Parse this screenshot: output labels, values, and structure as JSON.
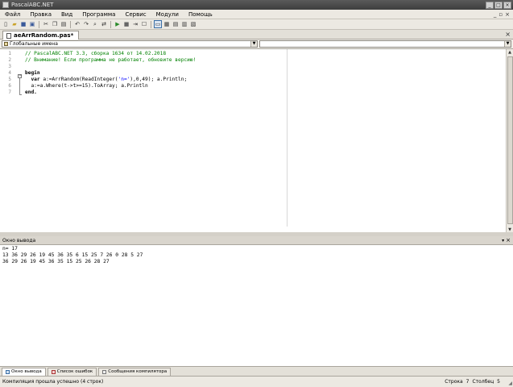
{
  "window": {
    "title": "PascalABC.NET"
  },
  "menu": {
    "items": [
      "Файл",
      "Правка",
      "Вид",
      "Программа",
      "Сервис",
      "Модули",
      "Помощь"
    ]
  },
  "toolbar": {
    "buttons": [
      "new-file",
      "open-folder",
      "save",
      "save-all",
      "cut",
      "copy",
      "paste",
      "undo",
      "redo",
      "find",
      "replace",
      "run",
      "stop",
      "step",
      "debug",
      "toggle-output",
      "form-designer",
      "options",
      "module-explorer",
      "help"
    ],
    "active": "toggle-output"
  },
  "file_tab": {
    "name": "aeArrRandom.pas*"
  },
  "scope_combo": {
    "value": "Глобальные имена"
  },
  "editor": {
    "line_numbers": [
      "1",
      "2",
      "3",
      "4",
      "5",
      "6",
      "7"
    ],
    "lines": [
      {
        "parts": [
          {
            "t": "// PascalABC.NET 3.3, сборка 1634 от 14.02.2018",
            "c": "green"
          }
        ]
      },
      {
        "parts": [
          {
            "t": "// Внимание! Если программа не работает, обновите версию!",
            "c": "green"
          }
        ]
      },
      {
        "parts": [
          {
            "t": "",
            "c": "plain"
          }
        ]
      },
      {
        "parts": [
          {
            "t": "begin",
            "c": "kw"
          }
        ]
      },
      {
        "parts": [
          {
            "t": "  ",
            "c": "plain"
          },
          {
            "t": "var",
            "c": "kw"
          },
          {
            "t": " a:=ArrRandom(ReadInteger(",
            "c": "plain"
          },
          {
            "t": "'n='",
            "c": "str"
          },
          {
            "t": "),0,49); a.Println;",
            "c": "plain"
          }
        ]
      },
      {
        "parts": [
          {
            "t": "  a:=a.Where(t->t>=15).ToArray; a.Println",
            "c": "plain"
          }
        ]
      },
      {
        "parts": [
          {
            "t": "end.",
            "c": "kw"
          }
        ]
      }
    ]
  },
  "output_panel": {
    "title": "Окно вывода",
    "lines": [
      "n= 17",
      "13 36 29 26 19 45 36 35 6 15 25 7 26 0 28 5 27",
      "36 29 26 19 45 36 35 15 25 26 28 27"
    ]
  },
  "bottom_tabs": [
    "Окно вывода",
    "Список ошибок",
    "Сообщения компилятора"
  ],
  "status": {
    "message": "Компиляция прошла успешно (4 строк)",
    "row_label": "Строка",
    "row": "7",
    "col_label": "Столбец",
    "col": "5"
  }
}
